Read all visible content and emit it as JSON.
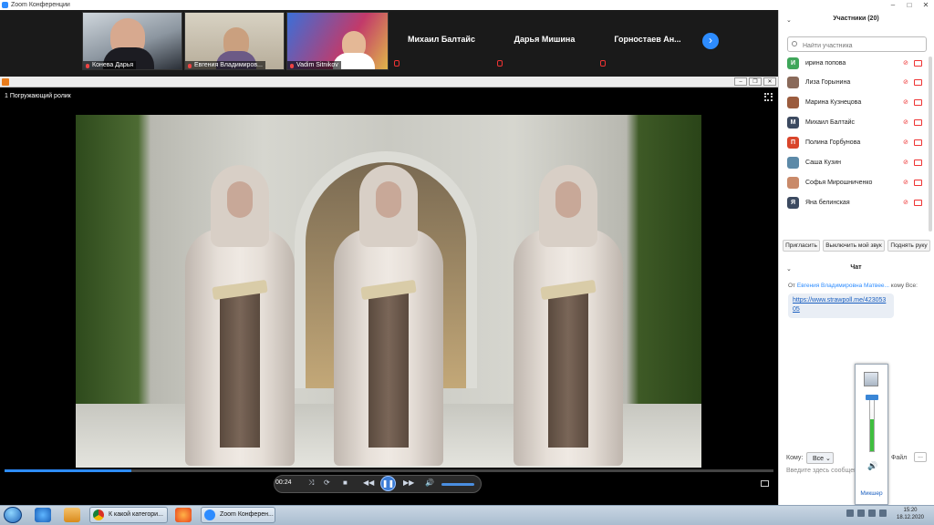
{
  "window": {
    "title": "Zoom Конференции"
  },
  "participants_strip": {
    "video_tiles": [
      {
        "name": "Конева Дарья"
      },
      {
        "name": "Евгения Владимиров..."
      },
      {
        "name": "Vadim Sitnikov"
      }
    ],
    "name_tiles": [
      {
        "name": "Михаил Балтайс"
      },
      {
        "name": "Дарья Мишина"
      },
      {
        "name": "Горностаев  Ан..."
      }
    ],
    "next_icon": "chevron-right-icon"
  },
  "player": {
    "video_title": "1 Погружающий ролик",
    "time": "00:24",
    "progress": 0.165,
    "volume": 0.85
  },
  "participants_panel": {
    "header": "Участники (20)",
    "search_placeholder": "Найти участника",
    "list": [
      {
        "initial": "И",
        "name": "ирина попова",
        "color": "#3fa65a"
      },
      {
        "initial": "",
        "name": "Лиза Горынина",
        "color": "#8a6a5a"
      },
      {
        "initial": "",
        "name": "Марина Кузнецова",
        "color": "#9b5c3e"
      },
      {
        "initial": "М",
        "name": "Михаил Балтайс",
        "color": "#3c4a60"
      },
      {
        "initial": "П",
        "name": "Полина Горбунова",
        "color": "#d9452b"
      },
      {
        "initial": "",
        "name": "Саша Кузин",
        "color": "#5c8aa8"
      },
      {
        "initial": "",
        "name": "Софья Мирошниченко",
        "color": "#c98a6a"
      },
      {
        "initial": "Я",
        "name": "Яна белинская",
        "color": "#3c4a60"
      }
    ],
    "buttons": {
      "invite": "Пригласить",
      "mute_me": "Выключить мой звук",
      "raise_hand": "Поднять руку"
    }
  },
  "chat": {
    "header": "Чат",
    "from_prefix": "От",
    "from_name": "Евгения Владимировна Матвее...",
    "to_text": "кому Все:",
    "message": "https://www.strawpoll.me/42305305",
    "to_label": "Кому:",
    "to_value": "Все",
    "file_label": "Файл",
    "more_label": "...",
    "input_placeholder": "Введите здесь сообщен"
  },
  "mixer": {
    "label": "Микшер",
    "level": 0.95
  },
  "taskbar": {
    "tasks": [
      {
        "label": "К какой категори...",
        "color": "#e8b418"
      },
      {
        "label": "Zoom Конферен...",
        "color": "#2d8cff"
      }
    ],
    "time": "15:20",
    "date": "18.12.2020"
  }
}
